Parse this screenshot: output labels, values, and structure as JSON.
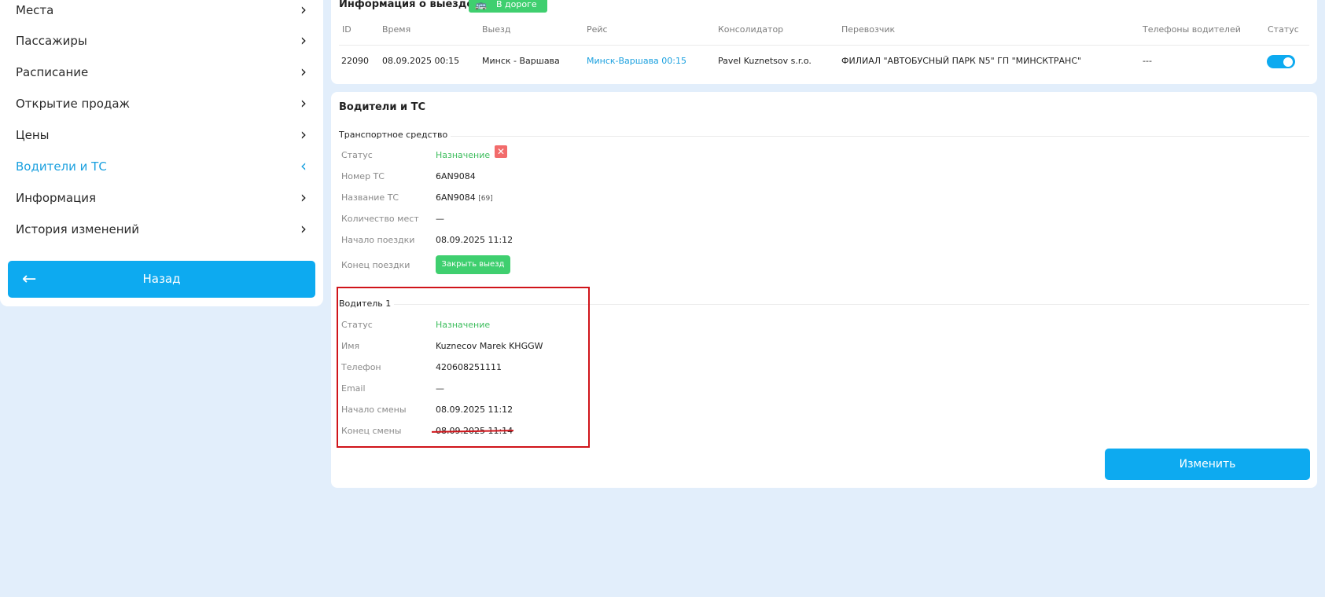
{
  "sidebar": {
    "items": [
      {
        "label": "Места",
        "active": false
      },
      {
        "label": "Пассажиры",
        "active": false
      },
      {
        "label": "Расписание",
        "active": false
      },
      {
        "label": "Открытие продаж",
        "active": false
      },
      {
        "label": "Цены",
        "active": false
      },
      {
        "label": "Водители и ТС",
        "active": true
      },
      {
        "label": "Информация",
        "active": false
      },
      {
        "label": "История изменений",
        "active": false
      }
    ],
    "back_label": "Назад",
    "back_icon": "arrow-left-icon",
    "chevron_icon": "chevron-right-icon"
  },
  "trip_info": {
    "title": "Информация о выезде",
    "badge": "В дороге",
    "badge_icon": "bus-icon",
    "columns": [
      "ID",
      "Время",
      "Выезд",
      "Рейс",
      "Консолидатор",
      "Перевозчик",
      "Телефоны водителей",
      "Статус"
    ],
    "row": {
      "id": "22090",
      "time": "08.09.2025 00:15",
      "departure": "Минск - Варшава",
      "route": "Минск-Варшава 00:15",
      "consolidator": "Pavel Kuznetsov s.r.o.",
      "carrier": "ФИЛИАЛ \"АВТОБУСНЫЙ ПАРК N5\" ГП \"МИНСКТРАНС\"",
      "driver_phones": "---",
      "status_on": true
    }
  },
  "drivers": {
    "title": "Водители и ТС",
    "vehicle": {
      "section_title": "Транспортное средство",
      "status_label": "Статус",
      "status_value": "Назначение",
      "number_label": "Номер ТС",
      "number_value": "6AN9084",
      "name_label": "Название ТС",
      "name_value": "6AN9084",
      "name_suffix": "[69]",
      "seats_label": "Количество мест",
      "seats_value": "—",
      "start_label": "Начало поездки",
      "start_value": "08.09.2025 11:12",
      "end_label": "Конец поездки",
      "close_button": "Закрыть выезд"
    },
    "driver1": {
      "section_title": "Водитель 1",
      "status_label": "Статус",
      "status_value": "Назначение",
      "name_label": "Имя",
      "name_value": "Kuznecov Marek KHGGW",
      "phone_label": "Телефон",
      "phone_value": "420608251111",
      "email_label": "Email",
      "email_value": "—",
      "shift_start_label": "Начало смены",
      "shift_start_value": "08.09.2025 11:12",
      "shift_end_label": "Конец смены",
      "shift_end_value": "08.09.2025 11:14"
    },
    "edit_button": "Изменить"
  },
  "colors": {
    "accent": "#0daaf0",
    "green": "#3fcf6f",
    "annotation_red": "#d0141a",
    "background": "#e2eefb"
  }
}
